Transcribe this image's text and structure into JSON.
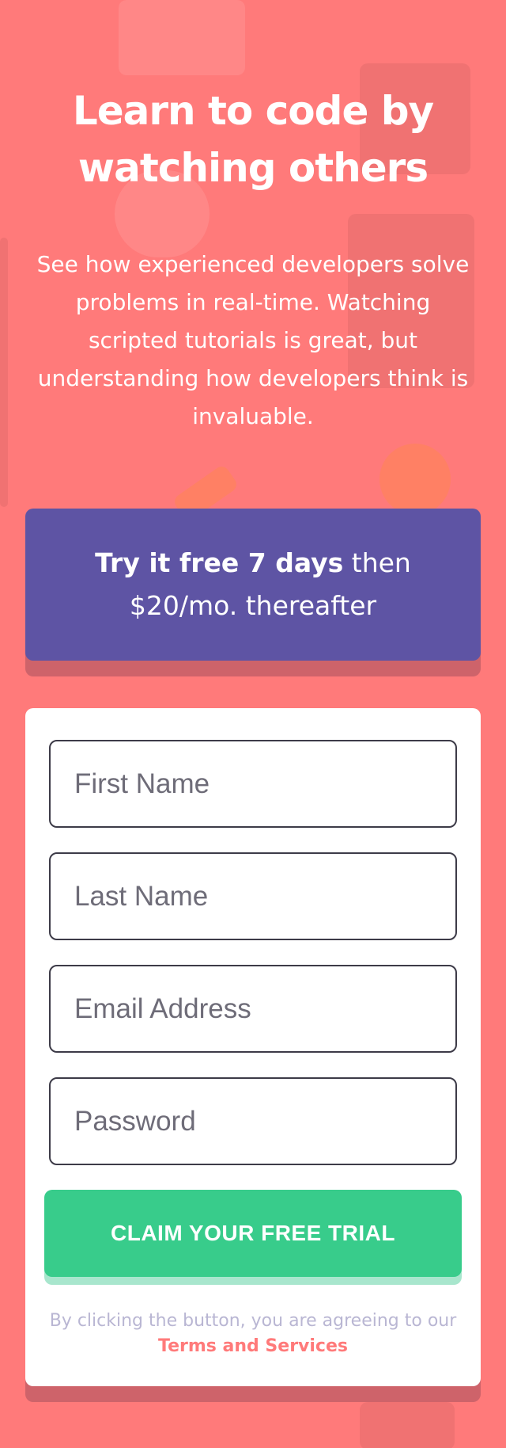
{
  "hero": {
    "title_line1": "Learn to code by",
    "title_line2": "watching others",
    "text": "See how experienced developers solve problems in real-time. Watching scripted tutorials is great, but understanding how developers think is invaluable."
  },
  "promo": {
    "bold": "Try it free 7 days",
    "rest_line1": " then",
    "rest_line2": "$20/mo. thereafter"
  },
  "form": {
    "first_name_placeholder": "First Name",
    "last_name_placeholder": "Last Name",
    "email_placeholder": "Email Address",
    "password_placeholder": "Password",
    "submit_label": "CLAIM YOUR FREE TRIAL",
    "terms_prefix": "By clicking the button, you are agreeing to our",
    "terms_link": "Terms and Services"
  },
  "colors": {
    "background": "#ff7a7a",
    "promo": "#5e54a4",
    "cta": "#38cc8b",
    "border": "#3d3b48",
    "terms_text": "#b9b6d3"
  },
  "background_pattern_icons": [
    "home-icon",
    "briefcase-icon",
    "network-icon",
    "pencil-icon",
    "gear-icon",
    "door-icon"
  ]
}
